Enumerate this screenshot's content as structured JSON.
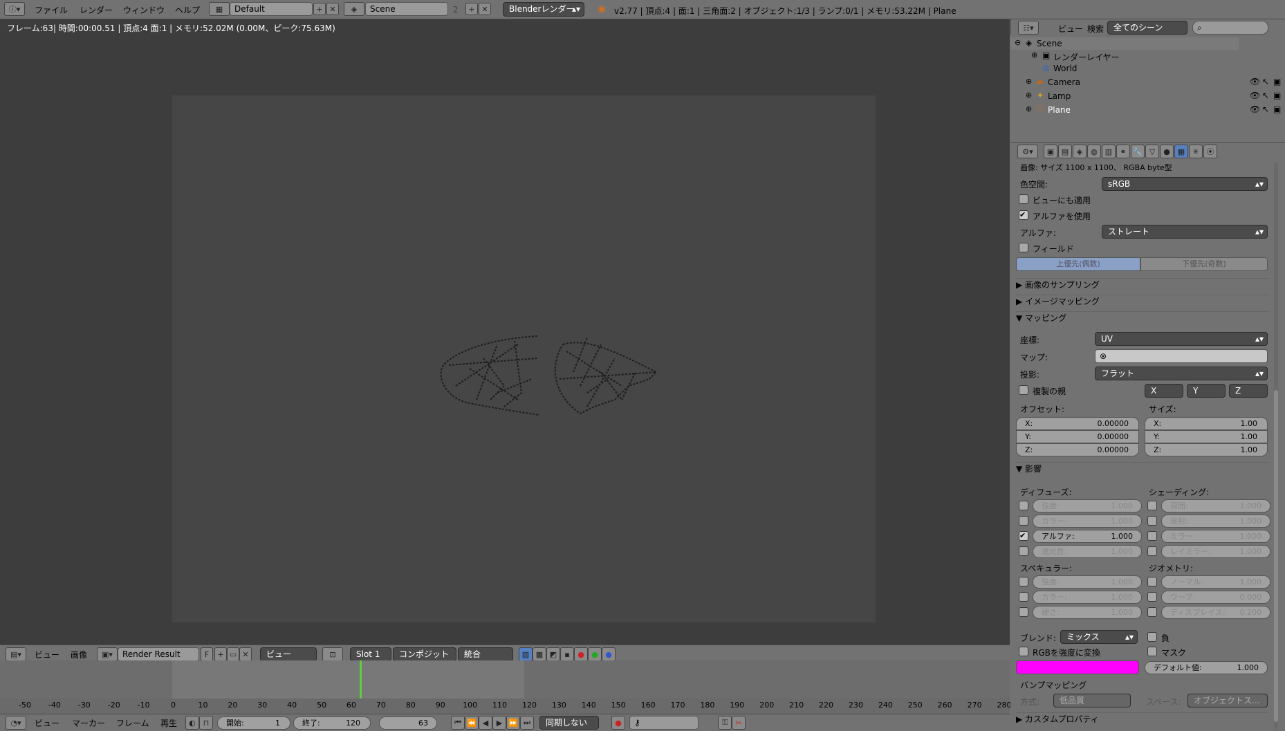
{
  "topbar": {
    "menus": [
      "ファイル",
      "レンダー",
      "ウィンドウ",
      "ヘルプ"
    ],
    "layout": "Default",
    "scene": "Scene",
    "scene_count": "2",
    "engine": "Blenderレンダー",
    "stats": "v2.77 | 頂点:4 | 面:1 | 三角面:2 | オブジェクト:1/3 | ランプ:0/1 | メモリ:53.22M | Plane"
  },
  "viewport": {
    "info": "フレーム:63| 時間:00:00.51 | 頂点:4 面:1 | メモリ:52.02M (0.00M、ピーク:75.63M)"
  },
  "image_header": {
    "menus": [
      "ビュー",
      "画像"
    ],
    "image_name": "Render Result",
    "fake_user": "F",
    "view": "ビュー",
    "slot": "Slot 1",
    "pass": "コンポジット",
    "layer": "統合"
  },
  "timeline": {
    "ticks": [
      "-50",
      "-40",
      "-30",
      "-20",
      "-10",
      "0",
      "10",
      "20",
      "30",
      "40",
      "50",
      "60",
      "70",
      "80",
      "90",
      "100",
      "110",
      "120",
      "130",
      "140",
      "150",
      "160",
      "170",
      "180",
      "190",
      "200",
      "210",
      "220",
      "230",
      "240",
      "250",
      "260",
      "270",
      "280"
    ],
    "current_frame_value": 63,
    "frame_min": -50,
    "frame_max": 280
  },
  "timeline_header": {
    "menus": [
      "ビュー",
      "マーカー",
      "フレーム",
      "再生"
    ],
    "start_label": "開始:",
    "start": "1",
    "end_label": "終了:",
    "end": "120",
    "current": "63",
    "sync": "同期しない"
  },
  "outliner": {
    "header_menus": [
      "ビュー",
      "検索"
    ],
    "scene_filter": "全てのシーン",
    "items": [
      {
        "name": "Scene"
      },
      {
        "name": "レンダーレイヤー"
      },
      {
        "name": "World"
      },
      {
        "name": "Camera"
      },
      {
        "name": "Lamp"
      },
      {
        "name": "Plane"
      }
    ]
  },
  "properties": {
    "image_info": "画像: サイズ 1100 x 1100、 RGBA byte型",
    "colorspace_label": "色空間:",
    "colorspace": "sRGB",
    "view_as_render": "ビューにも適用",
    "use_alpha": "アルファを使用",
    "alpha_label": "アルファ:",
    "alpha_mode": "ストレート",
    "fields": "フィールド",
    "upper_first": "上優先(偶数)",
    "lower_first": "下優先(奇数)",
    "sampling_panel": "画像のサンプリング",
    "image_mapping_panel": "イメージマッピング",
    "mapping_panel": "マッピング",
    "coords_label": "座標:",
    "coords": "UV",
    "map_label": "マップ:",
    "projection_label": "投影:",
    "projection": "フラット",
    "dupli_label": "複製の親",
    "axis_x": "X",
    "axis_y": "Y",
    "axis_z": "Z",
    "offset_label": "オフセット:",
    "size_label": "サイズ:",
    "offset": [
      {
        "axis": "X:",
        "value": "0.00000"
      },
      {
        "axis": "Y:",
        "value": "0.00000"
      },
      {
        "axis": "Z:",
        "value": "0.00000"
      }
    ],
    "size": [
      {
        "axis": "X:",
        "value": "1.00"
      },
      {
        "axis": "Y:",
        "value": "1.00"
      },
      {
        "axis": "Z:",
        "value": "1.00"
      }
    ],
    "influence_panel": "影響",
    "diffuse_label": "ディフューズ:",
    "shading_label": "シェーディング:",
    "specular_label": "スペキュラー:",
    "geometry_label": "ジオメトリ:",
    "diffuse": [
      {
        "label": "強度:",
        "value": "1.000"
      },
      {
        "label": "カラー:",
        "value": "1.000"
      },
      {
        "label": "アルファ:",
        "value": "1.000"
      },
      {
        "label": "透光性:",
        "value": "1.000"
      }
    ],
    "shading": [
      {
        "label": "周囲:",
        "value": "1.000"
      },
      {
        "label": "放射:",
        "value": "1.000"
      },
      {
        "label": "ミラー:",
        "value": "1.000"
      },
      {
        "label": "レイミラー:",
        "value": "1.000"
      }
    ],
    "specular": [
      {
        "label": "強度:",
        "value": "1.000"
      },
      {
        "label": "カラー:",
        "value": "1.000"
      },
      {
        "label": "硬さ:",
        "value": "1.000"
      }
    ],
    "geometry": [
      {
        "label": "ノーマル:",
        "value": "1.000"
      },
      {
        "label": "ワープ:",
        "value": "0.000"
      },
      {
        "label": "ディスプレイス:",
        "value": "0.200"
      }
    ],
    "blend_label": "ブレンド:",
    "blend": "ミックス",
    "negative": "負",
    "rgb_to_intensity": "RGBを強度に変換",
    "stencil": "マスク",
    "default_value": "デフォルト値:",
    "default_value_num": "1.000",
    "bump_panel": "バンプマッピング",
    "bump_method_label": "方式:",
    "bump_method": "低品質",
    "bump_space_label": "スペース:",
    "bump_space": "オブジェクトス...",
    "custom_props": "カスタムプロパティ",
    "color_swatch": "#ff00ff"
  }
}
